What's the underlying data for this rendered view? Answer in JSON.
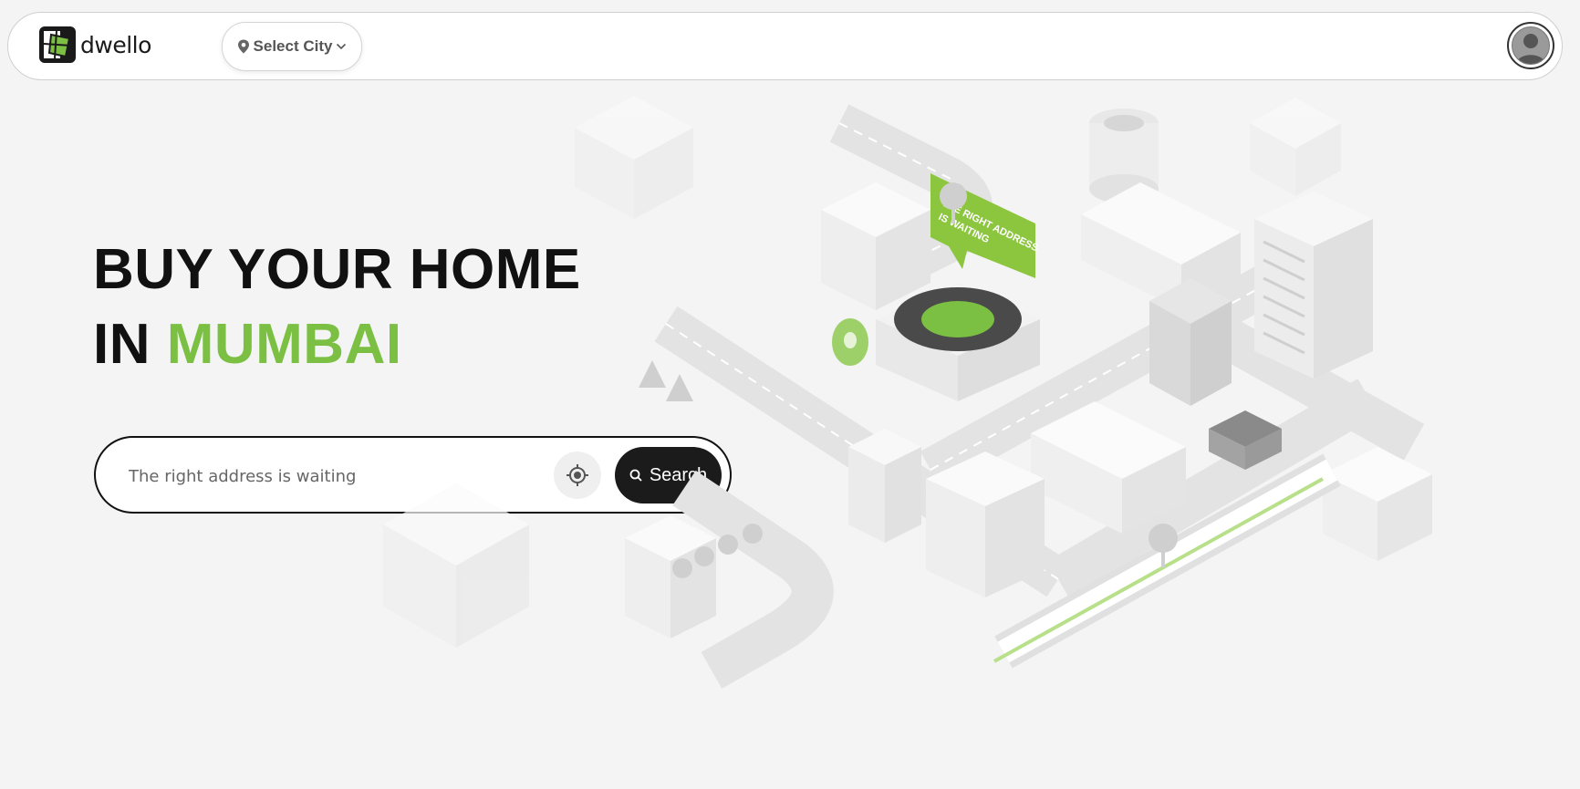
{
  "brand": {
    "name": "dwello",
    "accent_color": "#7bc043"
  },
  "header": {
    "city_selector": {
      "label": "Select City",
      "icon": "location-pin-icon",
      "caret": "chevron-down-icon"
    },
    "profile": {
      "icon": "user-avatar-icon"
    }
  },
  "hero": {
    "line1": "BUY YOUR HOME",
    "line2_prefix": "IN",
    "city": "MUMBAI"
  },
  "search": {
    "placeholder": "The right address is waiting",
    "locate_icon": "crosshair-icon",
    "button_label": "Search",
    "button_icon": "search-icon"
  },
  "illustration": {
    "sign_text_line1": "THE RIGHT ADDRESS",
    "sign_text_line2": "IS WAITING"
  }
}
